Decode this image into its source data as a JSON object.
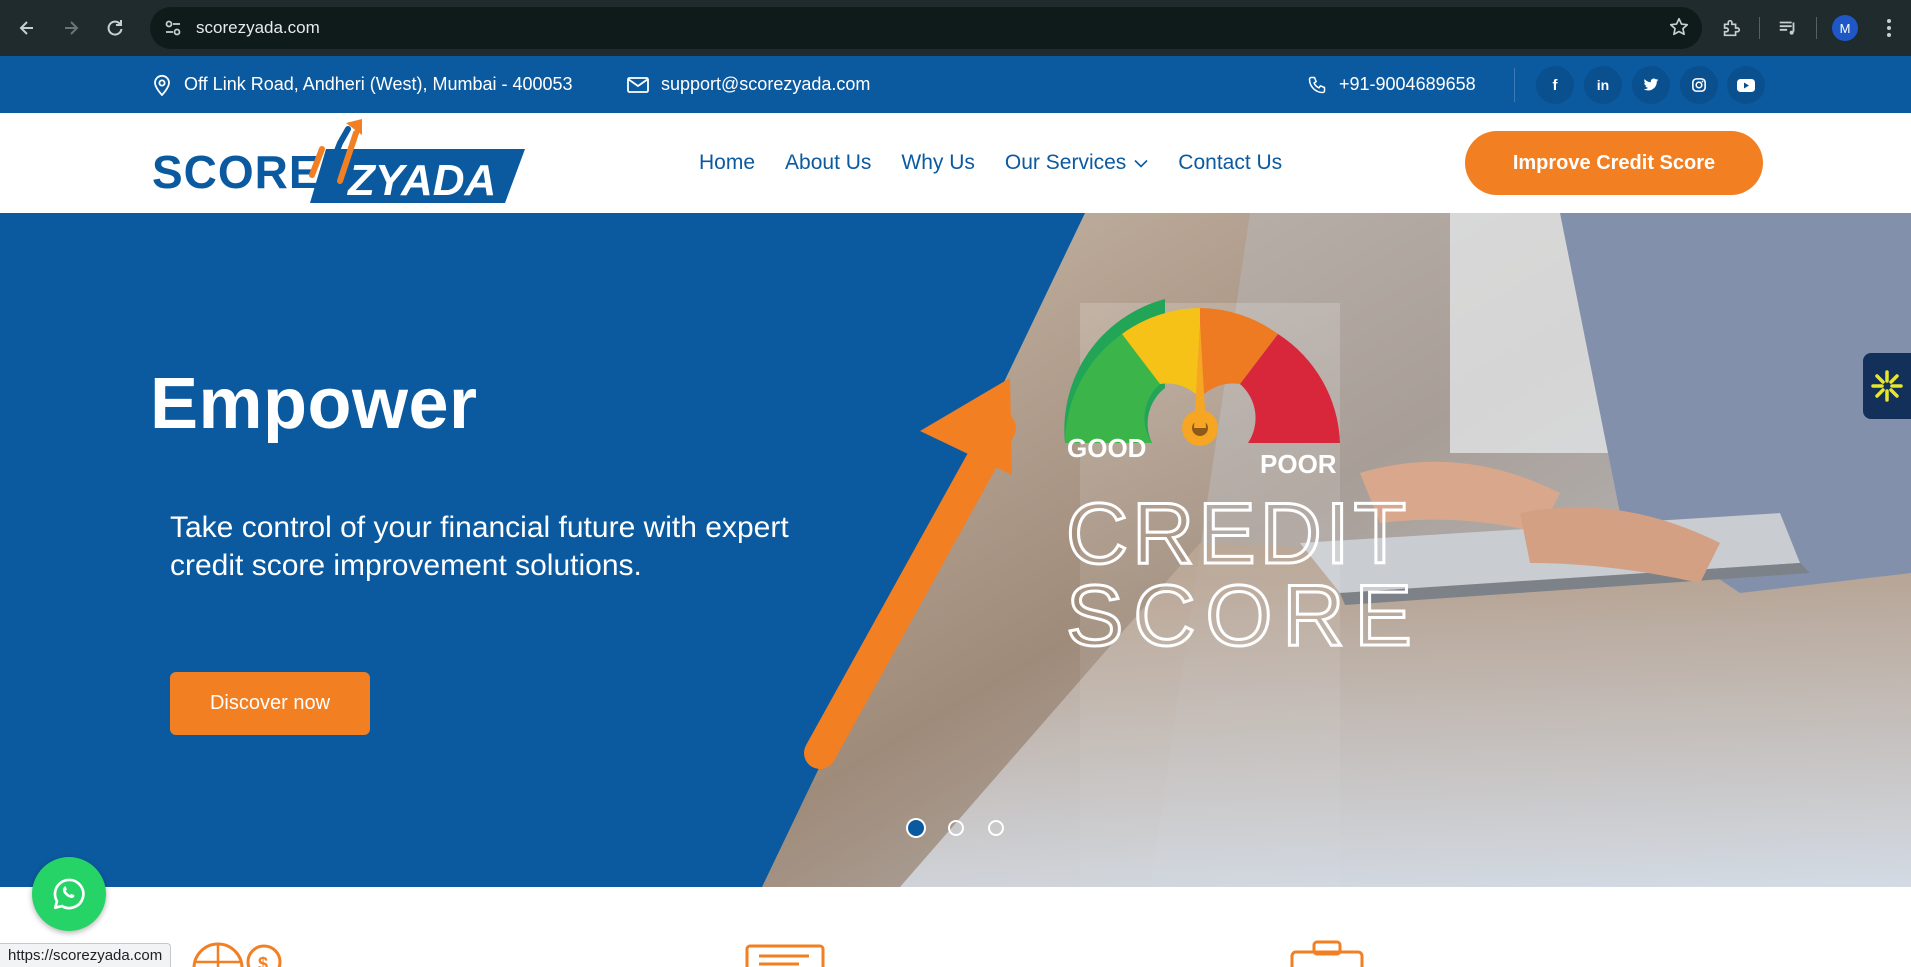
{
  "browser": {
    "url": "scorezyada.com",
    "profile_initial": "M",
    "status_url": "https://scorezyada.com"
  },
  "topbar": {
    "address": "Off Link Road, Andheri (West), Mumbai - 400053",
    "email": "support@scorezyada.com",
    "phone": "+91-9004689658",
    "socials": [
      "facebook-icon",
      "linkedin-icon",
      "twitter-icon",
      "instagram-icon",
      "youtube-icon"
    ]
  },
  "header": {
    "logo_left": "SCORE",
    "logo_right": "ZYADA",
    "menu": [
      {
        "label": "Home"
      },
      {
        "label": "About Us"
      },
      {
        "label": "Why Us"
      },
      {
        "label": "Our Services"
      },
      {
        "label": "Contact Us"
      }
    ],
    "cta_label": "Improve Credit Score"
  },
  "hero": {
    "title": "Empower",
    "subtitle": "Take control of your financial future with expert credit score improvement solutions.",
    "button_label": "Discover now",
    "image_text": {
      "good": "GOOD",
      "poor": "POOR",
      "line1": "CREDIT",
      "line2": "SCORE"
    },
    "slides": 3,
    "active_slide": 1
  },
  "colors": {
    "brand_blue": "#0b5aa0",
    "brand_orange": "#f27f22",
    "whatsapp_green": "#25d366"
  }
}
